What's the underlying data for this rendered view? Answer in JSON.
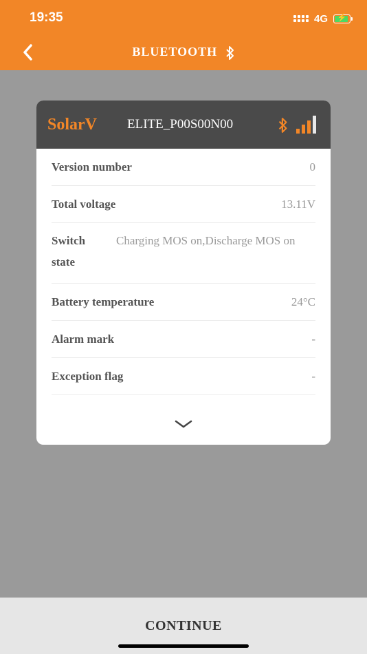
{
  "status_bar": {
    "time": "19:35",
    "network": "4G"
  },
  "header": {
    "title": "BLUETOOTH",
    "back_icon": "chevron-left-icon",
    "title_icon": "bluetooth-icon"
  },
  "card": {
    "brand": "SolarV",
    "device_name": "ELITE_P00S00N00",
    "signal_level": 3,
    "rows": [
      {
        "label": "Version number",
        "value": "0"
      },
      {
        "label": "Total voltage",
        "value": "13.11V"
      },
      {
        "label": "Switch state",
        "value": "Charging MOS on,Discharge MOS on"
      },
      {
        "label": "Battery temperature",
        "value": "24°C"
      },
      {
        "label": "Alarm mark",
        "value": "-"
      },
      {
        "label": "Exception flag",
        "value": "-"
      }
    ]
  },
  "footer": {
    "continue_label": "CONTINUE"
  },
  "colors": {
    "accent": "#f28627",
    "card_header": "#4a4a4a",
    "overlay": "#9a9a9a"
  }
}
